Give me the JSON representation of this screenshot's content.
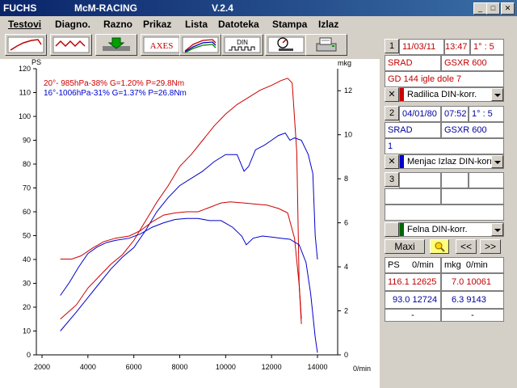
{
  "window": {
    "title_left": "FUCHS",
    "title_center": "McM-RACING",
    "title_version": "V.2.4"
  },
  "menu": [
    "Testovi",
    "Diagno.",
    "Razno",
    "Prikaz",
    "Lista",
    "Datoteka",
    "Stampa",
    "Izlaz"
  ],
  "toolbar": {
    "axes_label": "AXES",
    "din_label": "DIN"
  },
  "tests": [
    {
      "index": "1",
      "date": "11/03/11",
      "time": "13:47",
      "ratio": "1° : 5",
      "type": "SRAD",
      "model": "GSXR 600",
      "note": "GD 144 igle dole 7",
      "correction": "Radilica DIN-korr.",
      "color": "#cc0000"
    },
    {
      "index": "2",
      "date": "04/01/80",
      "time": "07:52",
      "ratio": "1° : 5",
      "type": "SRAD",
      "model": "GSXR 600",
      "note": "1",
      "correction": "Menjac Izlaz DIN-korr",
      "color": "#0000cc"
    },
    {
      "index": "3",
      "correction": "Felna DIN-korr.",
      "color": "#006600"
    }
  ],
  "buttons": {
    "maxi": "Maxi",
    "prev": "<<",
    "next": ">>"
  },
  "results": {
    "headers": [
      "PS",
      "0/min",
      "mkg",
      "0/min"
    ],
    "rows": [
      {
        "ps": "116.1",
        "ps_rpm": "12625",
        "mkg": "7.0",
        "mkg_rpm": "10061"
      },
      {
        "ps": "93.0",
        "ps_rpm": "12724",
        "mkg": "6.3",
        "mkg_rpm": "9143"
      },
      {
        "ps": "-",
        "ps_rpm": "",
        "mkg": "-",
        "mkg_rpm": ""
      }
    ]
  },
  "chart_data": {
    "type": "line",
    "xlabel": "0/min",
    "ylabel_left": "PS",
    "ylabel_right": "mkg",
    "xlim": [
      2000,
      14000
    ],
    "ylim_left": [
      0,
      120
    ],
    "ylim_right": [
      0,
      13
    ],
    "x_ticks": [
      2000,
      4000,
      6000,
      8000,
      10000,
      12000,
      14000
    ],
    "y_left_ticks": [
      0,
      10,
      20,
      30,
      40,
      50,
      60,
      70,
      80,
      90,
      100,
      110,
      120
    ],
    "y_right_ticks": [
      0,
      2,
      4,
      6,
      8,
      10,
      12
    ],
    "legend": [
      {
        "text": "20°- 985hPa-38% G=1.20% P=29.8Nm",
        "color": "#cc0000"
      },
      {
        "text": "16°-1006hPa-31% G=1.37% P=26.8Nm",
        "color": "#0000cc"
      }
    ],
    "series": [
      {
        "color": "#cc0000",
        "axis": "left",
        "x": [
          2800,
          3500,
          4000,
          4500,
          5000,
          5500,
          6000,
          6500,
          7000,
          7500,
          8000,
          8500,
          9000,
          9500,
          10000,
          10500,
          11000,
          11500,
          12000,
          12400,
          12700,
          12900,
          13100,
          13200,
          13300
        ],
        "y": [
          15,
          21,
          28,
          33,
          38,
          42,
          48,
          56,
          64,
          71,
          79,
          84,
          90,
          96,
          101,
          105,
          108,
          111,
          113,
          115,
          116,
          114,
          85,
          30,
          15
        ]
      },
      {
        "color": "#0000cc",
        "axis": "left",
        "x": [
          2800,
          3500,
          4000,
          4500,
          5000,
          5500,
          6000,
          6500,
          7000,
          7500,
          8000,
          8500,
          9000,
          9500,
          10000,
          10500,
          10800,
          11000,
          11300,
          11700,
          12000,
          12300,
          12600,
          12800,
          13000,
          13300,
          13600,
          13800,
          13900,
          14000
        ],
        "y": [
          10,
          18,
          24,
          30,
          36,
          41,
          45,
          52,
          60,
          66,
          71,
          74,
          77,
          81,
          84,
          84,
          77,
          79,
          86,
          88,
          90,
          92,
          93,
          90,
          91,
          90,
          84,
          76,
          50,
          40
        ]
      },
      {
        "color": "#cc0000",
        "axis": "right",
        "x": [
          2800,
          3300,
          3700,
          4200,
          4700,
          5200,
          5800,
          6300,
          6800,
          7300,
          7800,
          8300,
          8800,
          9300,
          9800,
          10200,
          10800,
          11300,
          11800,
          12300,
          12700,
          13000,
          13200,
          13300
        ],
        "y": [
          4.35,
          4.35,
          4.5,
          4.85,
          5.15,
          5.3,
          5.4,
          5.65,
          6.05,
          6.35,
          6.45,
          6.5,
          6.5,
          6.7,
          6.9,
          6.95,
          6.9,
          6.85,
          6.8,
          6.65,
          6.45,
          5.3,
          3.2,
          1.4
        ]
      },
      {
        "color": "#0000cc",
        "axis": "right",
        "x": [
          2800,
          3200,
          3600,
          4000,
          4400,
          4800,
          5200,
          5800,
          6300,
          6800,
          7300,
          7800,
          8300,
          8800,
          9300,
          9800,
          10300,
          10700,
          10900,
          11200,
          11600,
          12000,
          12400,
          12800,
          13200,
          13500,
          13700,
          13900,
          14000
        ],
        "y": [
          2.7,
          3.3,
          4.0,
          4.6,
          4.9,
          5.1,
          5.2,
          5.3,
          5.5,
          5.8,
          6.0,
          6.15,
          6.2,
          6.2,
          6.1,
          6.1,
          5.8,
          5.4,
          5.0,
          5.3,
          5.4,
          5.35,
          5.3,
          5.25,
          5.0,
          4.2,
          2.8,
          0.8,
          0.1
        ]
      }
    ]
  }
}
